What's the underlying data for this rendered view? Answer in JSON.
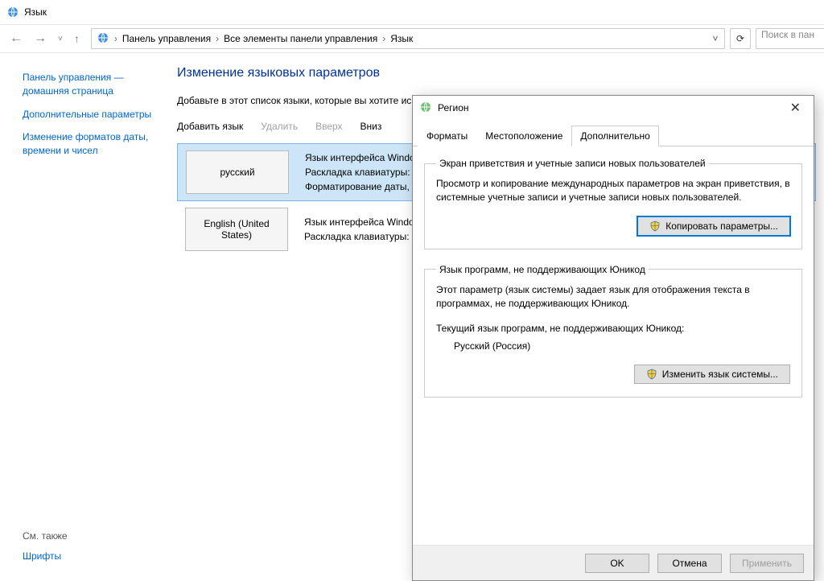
{
  "window": {
    "title": "Язык"
  },
  "nav": {
    "back_icon": "←",
    "forward_icon": "→",
    "recent_icon": "˅",
    "up_icon": "↑",
    "breadcrumb": [
      "Панель управления",
      "Все элементы панели управления",
      "Язык"
    ],
    "sep": "›",
    "dropdown_icon": "˅",
    "refresh_icon": "⟳",
    "search_placeholder": "Поиск в пан"
  },
  "sidebar": {
    "items": [
      "Панель управления — домашняя страница",
      "Дополнительные параметры",
      "Изменение форматов даты, времени и чисел"
    ],
    "seealso_heading": "См. также",
    "seealso_link": "Шрифты"
  },
  "main": {
    "heading": "Изменение языковых параметров",
    "subtext": "Добавьте в этот список языки, которые вы хотите использовать).",
    "commands": {
      "add": "Добавить язык",
      "remove": "Удалить",
      "up": "Вверх",
      "down": "Вниз"
    },
    "langs": [
      {
        "name": "русский",
        "desc": "Язык интерфейса Windows\nРаскладка клавиатуры: Ру\nФорматирование даты, вр",
        "selected": true
      },
      {
        "name": "English (United States)",
        "desc": "Язык интерфейса Windows\nРаскладка клавиатуры: СШ",
        "selected": false
      }
    ]
  },
  "dialog": {
    "title": "Регион",
    "tabs": {
      "formats": "Форматы",
      "location": "Местоположение",
      "advanced": "Дополнительно"
    },
    "group1": {
      "legend": "Экран приветствия и учетные записи новых пользователей",
      "desc": "Просмотр и копирование международных параметров на экран приветствия, в системные учетные записи и учетные записи новых пользователей.",
      "button": "Копировать параметры..."
    },
    "group2": {
      "legend": "Язык программ, не поддерживающих Юникод",
      "desc": "Этот параметр (язык системы) задает язык для отображения текста в программах, не поддерживающих Юникод.",
      "current_label": "Текущий язык программ, не поддерживающих Юникод:",
      "current_value": "Русский (Россия)",
      "button": "Изменить язык системы..."
    },
    "footer": {
      "ok": "OK",
      "cancel": "Отмена",
      "apply": "Применить"
    }
  }
}
